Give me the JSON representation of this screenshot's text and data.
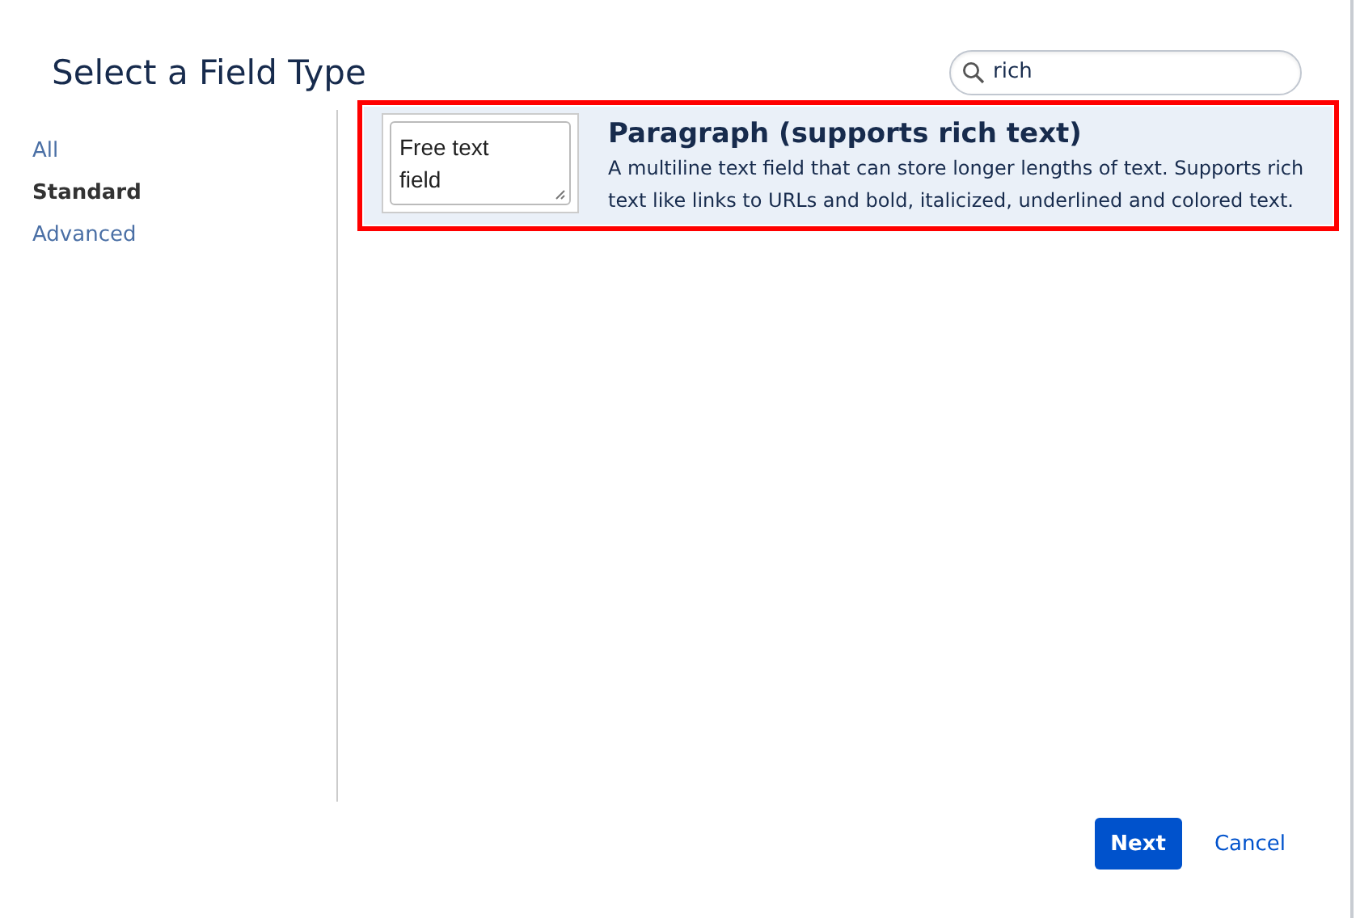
{
  "dialog": {
    "title": "Select a Field Type"
  },
  "search": {
    "value": "rich"
  },
  "sidebar": {
    "items": [
      {
        "label": "All",
        "selected": false
      },
      {
        "label": "Standard",
        "selected": true
      },
      {
        "label": "Advanced",
        "selected": false
      }
    ]
  },
  "field_types": [
    {
      "preview": "Free text field",
      "name": "Paragraph (supports rich text)",
      "description": "A multiline text field that can store longer lengths of text. Supports rich text like links to URLs and bold, italicized, underlined and colored text.",
      "selected": true,
      "highlighted": true
    }
  ],
  "buttons": [
    {
      "label": "Next",
      "kind": "primary"
    },
    {
      "label": "Cancel",
      "kind": "link"
    }
  ]
}
